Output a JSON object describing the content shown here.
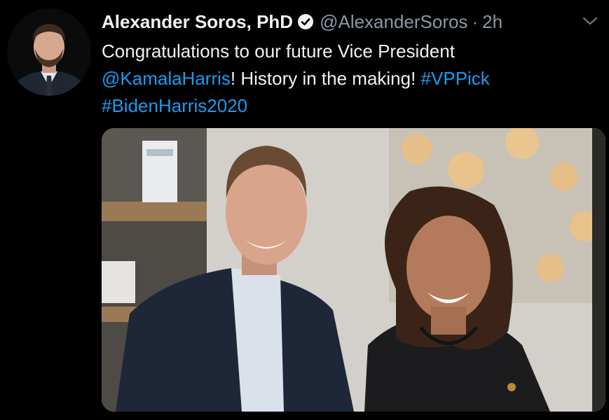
{
  "tweet": {
    "display_name": "Alexander Soros, PhD",
    "handle": "@AlexanderSoros",
    "separator": "·",
    "time": "2h",
    "text": {
      "line1": "Congratulations to our future Vice President",
      "mention": "@KamalaHarris",
      "line2_rest": "! History in the making! ",
      "hashtag1": "#VPPick",
      "hashtag2": "#BidenHarris2020"
    }
  },
  "icons": {
    "verified": "verified-badge-icon",
    "menu": "chevron-down-icon"
  },
  "colors": {
    "background": "#000000",
    "link": "#1d9bf0",
    "muted": "#8b98a5",
    "text": "#f2f2f2"
  }
}
